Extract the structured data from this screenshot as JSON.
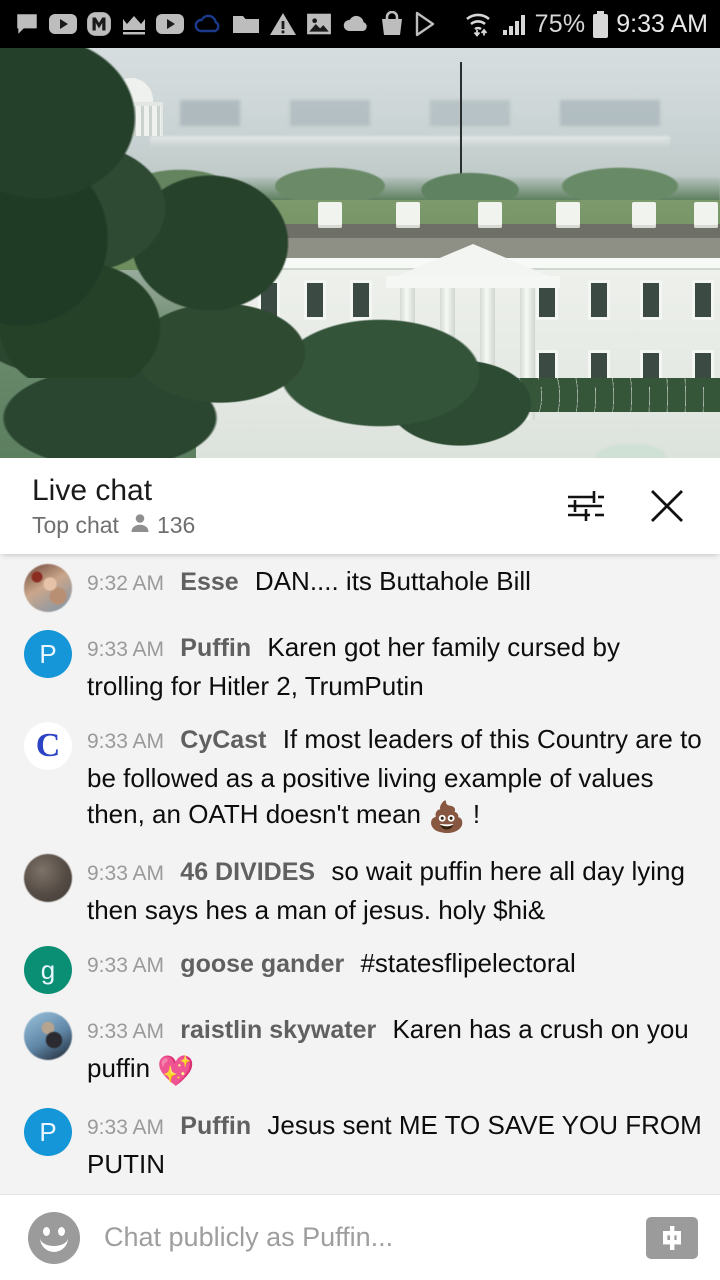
{
  "status_bar": {
    "icons": [
      "message-icon",
      "youtube-icon",
      "m-badge-icon",
      "crown-icon",
      "youtube-icon-2",
      "cloud-outline-icon",
      "folder-icon",
      "warning-icon",
      "image-icon",
      "cloud-icon",
      "shopping-bag-icon",
      "play-store-icon"
    ],
    "wifi_icon": "wifi-data-icon",
    "signal_icon": "cellular-signal-icon",
    "battery_percent": "75%",
    "battery_icon": "battery-icon",
    "time": "9:33 AM"
  },
  "video": {
    "name": "white-house-live-stream",
    "live_bar_color": "#ee0000"
  },
  "chat_header": {
    "title": "Live chat",
    "mode": "Top chat",
    "viewer_icon": "person-icon",
    "viewer_count": "136",
    "filter_icon": "tune-sliders-icon",
    "close_icon": "close-icon"
  },
  "messages": [
    {
      "time": "9:32 AM",
      "author": "Esse",
      "text": "DAN.... its Buttahole Bill",
      "avatar_type": "photo-esse",
      "avatar_letter": ""
    },
    {
      "time": "9:33 AM",
      "author": "Puffin",
      "text": "Karen got her family cursed by trolling for Hitler 2, TrumPutin",
      "avatar_type": "letter-blue",
      "avatar_letter": "P"
    },
    {
      "time": "9:33 AM",
      "author": "CyCast",
      "text": "If most leaders of this Country are to be followed as a positive living example of values then, an OATH doesn't mean ",
      "text_after_emoji": "!",
      "emoji": "💩",
      "avatar_type": "logo-cycast",
      "avatar_letter": "C"
    },
    {
      "time": "9:33 AM",
      "author": "46 DIVIDES",
      "text": "so wait puffin here all day lying then says hes a man of jesus. holy $hi&",
      "avatar_type": "photo-dark",
      "avatar_letter": ""
    },
    {
      "time": "9:33 AM",
      "author": "goose gander",
      "text": "#statesflipelectoral",
      "avatar_type": "letter-green",
      "avatar_letter": "g"
    },
    {
      "time": "9:33 AM",
      "author": "raistlin skywater",
      "text": "Karen has a crush on you puffin ",
      "text_after_emoji": "",
      "emoji": "💖",
      "avatar_type": "photo-raistlin",
      "avatar_letter": ""
    },
    {
      "time": "9:33 AM",
      "author": "Puffin",
      "text": "Jesus sent ME TO SAVE YOU FROM PUTIN",
      "avatar_type": "letter-blue",
      "avatar_letter": "P"
    }
  ],
  "input_bar": {
    "emoji_icon": "emoji-smiley-icon",
    "placeholder": "Chat publicly as Puffin...",
    "value": "",
    "money_icon": "super-chat-dollar-icon"
  },
  "colors": {
    "accent_red": "#ee0000",
    "avatar_blue": "#1596d8",
    "avatar_green": "#0a8f74",
    "cycast_blue": "#2b43c4",
    "chat_bg": "#f3f3f3",
    "author_gray": "#606060",
    "time_gray": "#9a9a9a"
  }
}
